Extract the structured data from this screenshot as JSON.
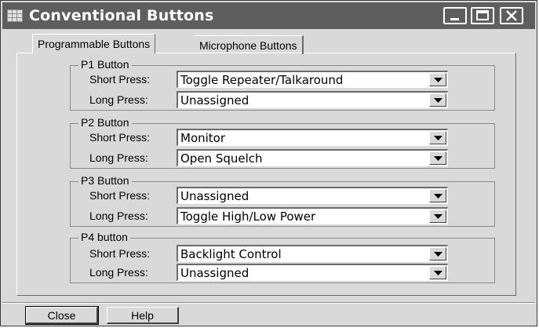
{
  "window": {
    "title": "Conventional Buttons"
  },
  "tabs": [
    {
      "label": "Programmable Buttons",
      "active": true
    },
    {
      "label": "Microphone Buttons",
      "active": false
    }
  ],
  "labels": {
    "short_press": "Short Press:",
    "long_press": "Long Press:"
  },
  "groups": [
    {
      "title": "P1 Button",
      "short_value": "Toggle Repeater/Talkaround",
      "long_value": "Unassigned"
    },
    {
      "title": "P2 Button",
      "short_value": "Monitor",
      "long_value": "Open Squelch"
    },
    {
      "title": "P3 Button",
      "short_value": "Unassigned",
      "long_value": "Toggle High/Low Power"
    },
    {
      "title": "P4 button",
      "short_value": "Backlight Control",
      "long_value": "Unassigned"
    }
  ],
  "footer": {
    "close_label": "Close",
    "help_label": "Help"
  },
  "icons": {
    "app": "app-grid-icon",
    "minimize": "minimize-icon",
    "maximize": "maximize-icon",
    "close": "close-icon",
    "dropdown": "chevron-down-icon"
  }
}
